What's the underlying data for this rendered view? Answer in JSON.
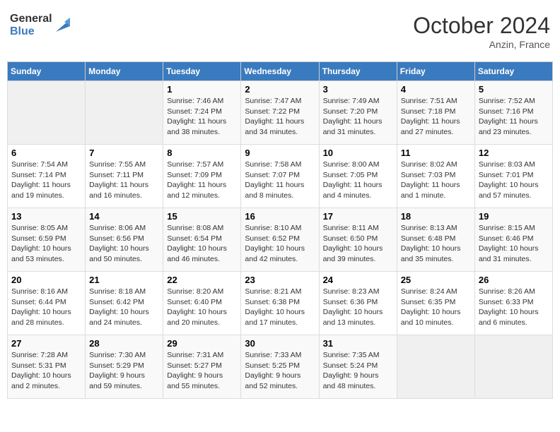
{
  "header": {
    "logo_line1": "General",
    "logo_line2": "Blue",
    "month": "October 2024",
    "location": "Anzin, France"
  },
  "days_of_week": [
    "Sunday",
    "Monday",
    "Tuesday",
    "Wednesday",
    "Thursday",
    "Friday",
    "Saturday"
  ],
  "weeks": [
    [
      {
        "num": "",
        "empty": true
      },
      {
        "num": "",
        "empty": true
      },
      {
        "num": "1",
        "sunrise": "Sunrise: 7:46 AM",
        "sunset": "Sunset: 7:24 PM",
        "daylight": "Daylight: 11 hours and 38 minutes."
      },
      {
        "num": "2",
        "sunrise": "Sunrise: 7:47 AM",
        "sunset": "Sunset: 7:22 PM",
        "daylight": "Daylight: 11 hours and 34 minutes."
      },
      {
        "num": "3",
        "sunrise": "Sunrise: 7:49 AM",
        "sunset": "Sunset: 7:20 PM",
        "daylight": "Daylight: 11 hours and 31 minutes."
      },
      {
        "num": "4",
        "sunrise": "Sunrise: 7:51 AM",
        "sunset": "Sunset: 7:18 PM",
        "daylight": "Daylight: 11 hours and 27 minutes."
      },
      {
        "num": "5",
        "sunrise": "Sunrise: 7:52 AM",
        "sunset": "Sunset: 7:16 PM",
        "daylight": "Daylight: 11 hours and 23 minutes."
      }
    ],
    [
      {
        "num": "6",
        "sunrise": "Sunrise: 7:54 AM",
        "sunset": "Sunset: 7:14 PM",
        "daylight": "Daylight: 11 hours and 19 minutes."
      },
      {
        "num": "7",
        "sunrise": "Sunrise: 7:55 AM",
        "sunset": "Sunset: 7:11 PM",
        "daylight": "Daylight: 11 hours and 16 minutes."
      },
      {
        "num": "8",
        "sunrise": "Sunrise: 7:57 AM",
        "sunset": "Sunset: 7:09 PM",
        "daylight": "Daylight: 11 hours and 12 minutes."
      },
      {
        "num": "9",
        "sunrise": "Sunrise: 7:58 AM",
        "sunset": "Sunset: 7:07 PM",
        "daylight": "Daylight: 11 hours and 8 minutes."
      },
      {
        "num": "10",
        "sunrise": "Sunrise: 8:00 AM",
        "sunset": "Sunset: 7:05 PM",
        "daylight": "Daylight: 11 hours and 4 minutes."
      },
      {
        "num": "11",
        "sunrise": "Sunrise: 8:02 AM",
        "sunset": "Sunset: 7:03 PM",
        "daylight": "Daylight: 11 hours and 1 minute."
      },
      {
        "num": "12",
        "sunrise": "Sunrise: 8:03 AM",
        "sunset": "Sunset: 7:01 PM",
        "daylight": "Daylight: 10 hours and 57 minutes."
      }
    ],
    [
      {
        "num": "13",
        "sunrise": "Sunrise: 8:05 AM",
        "sunset": "Sunset: 6:59 PM",
        "daylight": "Daylight: 10 hours and 53 minutes."
      },
      {
        "num": "14",
        "sunrise": "Sunrise: 8:06 AM",
        "sunset": "Sunset: 6:56 PM",
        "daylight": "Daylight: 10 hours and 50 minutes."
      },
      {
        "num": "15",
        "sunrise": "Sunrise: 8:08 AM",
        "sunset": "Sunset: 6:54 PM",
        "daylight": "Daylight: 10 hours and 46 minutes."
      },
      {
        "num": "16",
        "sunrise": "Sunrise: 8:10 AM",
        "sunset": "Sunset: 6:52 PM",
        "daylight": "Daylight: 10 hours and 42 minutes."
      },
      {
        "num": "17",
        "sunrise": "Sunrise: 8:11 AM",
        "sunset": "Sunset: 6:50 PM",
        "daylight": "Daylight: 10 hours and 39 minutes."
      },
      {
        "num": "18",
        "sunrise": "Sunrise: 8:13 AM",
        "sunset": "Sunset: 6:48 PM",
        "daylight": "Daylight: 10 hours and 35 minutes."
      },
      {
        "num": "19",
        "sunrise": "Sunrise: 8:15 AM",
        "sunset": "Sunset: 6:46 PM",
        "daylight": "Daylight: 10 hours and 31 minutes."
      }
    ],
    [
      {
        "num": "20",
        "sunrise": "Sunrise: 8:16 AM",
        "sunset": "Sunset: 6:44 PM",
        "daylight": "Daylight: 10 hours and 28 minutes."
      },
      {
        "num": "21",
        "sunrise": "Sunrise: 8:18 AM",
        "sunset": "Sunset: 6:42 PM",
        "daylight": "Daylight: 10 hours and 24 minutes."
      },
      {
        "num": "22",
        "sunrise": "Sunrise: 8:20 AM",
        "sunset": "Sunset: 6:40 PM",
        "daylight": "Daylight: 10 hours and 20 minutes."
      },
      {
        "num": "23",
        "sunrise": "Sunrise: 8:21 AM",
        "sunset": "Sunset: 6:38 PM",
        "daylight": "Daylight: 10 hours and 17 minutes."
      },
      {
        "num": "24",
        "sunrise": "Sunrise: 8:23 AM",
        "sunset": "Sunset: 6:36 PM",
        "daylight": "Daylight: 10 hours and 13 minutes."
      },
      {
        "num": "25",
        "sunrise": "Sunrise: 8:24 AM",
        "sunset": "Sunset: 6:35 PM",
        "daylight": "Daylight: 10 hours and 10 minutes."
      },
      {
        "num": "26",
        "sunrise": "Sunrise: 8:26 AM",
        "sunset": "Sunset: 6:33 PM",
        "daylight": "Daylight: 10 hours and 6 minutes."
      }
    ],
    [
      {
        "num": "27",
        "sunrise": "Sunrise: 7:28 AM",
        "sunset": "Sunset: 5:31 PM",
        "daylight": "Daylight: 10 hours and 2 minutes."
      },
      {
        "num": "28",
        "sunrise": "Sunrise: 7:30 AM",
        "sunset": "Sunset: 5:29 PM",
        "daylight": "Daylight: 9 hours and 59 minutes."
      },
      {
        "num": "29",
        "sunrise": "Sunrise: 7:31 AM",
        "sunset": "Sunset: 5:27 PM",
        "daylight": "Daylight: 9 hours and 55 minutes."
      },
      {
        "num": "30",
        "sunrise": "Sunrise: 7:33 AM",
        "sunset": "Sunset: 5:25 PM",
        "daylight": "Daylight: 9 hours and 52 minutes."
      },
      {
        "num": "31",
        "sunrise": "Sunrise: 7:35 AM",
        "sunset": "Sunset: 5:24 PM",
        "daylight": "Daylight: 9 hours and 48 minutes."
      },
      {
        "num": "",
        "empty": true
      },
      {
        "num": "",
        "empty": true
      }
    ]
  ]
}
